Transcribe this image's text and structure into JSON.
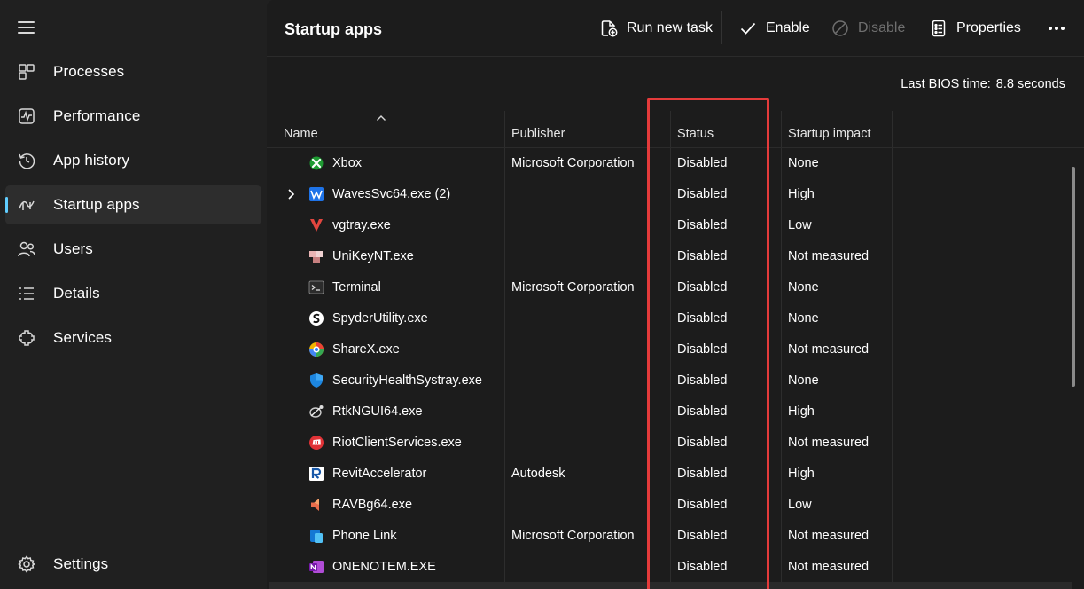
{
  "sidebar": {
    "items": [
      {
        "label": "Processes",
        "icon": "processes-icon"
      },
      {
        "label": "Performance",
        "icon": "performance-icon"
      },
      {
        "label": "App history",
        "icon": "app-history-icon"
      },
      {
        "label": "Startup apps",
        "icon": "startup-apps-icon",
        "active": true
      },
      {
        "label": "Users",
        "icon": "users-icon"
      },
      {
        "label": "Details",
        "icon": "details-icon"
      },
      {
        "label": "Services",
        "icon": "services-icon"
      }
    ],
    "settings": {
      "label": "Settings",
      "icon": "gear-icon"
    }
  },
  "header": {
    "title": "Startup apps",
    "run_new_task": "Run new task",
    "enable": "Enable",
    "disable": "Disable",
    "properties": "Properties"
  },
  "bios": {
    "label": "Last BIOS time:",
    "value": "8.8 seconds"
  },
  "table": {
    "columns": [
      "Name",
      "Publisher",
      "Status",
      "Startup impact"
    ],
    "rows": [
      {
        "name": "Xbox",
        "publisher": "Microsoft Corporation",
        "status": "Disabled",
        "impact": "None",
        "icon": "xbox-icon"
      },
      {
        "name": "WavesSvc64.exe (2)",
        "publisher": "",
        "status": "Disabled",
        "impact": "High",
        "icon": "waves-icon",
        "expandable": true
      },
      {
        "name": "vgtray.exe",
        "publisher": "",
        "status": "Disabled",
        "impact": "Low",
        "icon": "vanguard-icon"
      },
      {
        "name": "UniKeyNT.exe",
        "publisher": "",
        "status": "Disabled",
        "impact": "Not measured",
        "icon": "unikey-icon"
      },
      {
        "name": "Terminal",
        "publisher": "Microsoft Corporation",
        "status": "Disabled",
        "impact": "None",
        "icon": "terminal-icon"
      },
      {
        "name": "SpyderUtility.exe",
        "publisher": "",
        "status": "Disabled",
        "impact": "None",
        "icon": "spyder-icon"
      },
      {
        "name": "ShareX.exe",
        "publisher": "",
        "status": "Disabled",
        "impact": "Not measured",
        "icon": "sharex-icon"
      },
      {
        "name": "SecurityHealthSystray.exe",
        "publisher": "",
        "status": "Disabled",
        "impact": "None",
        "icon": "security-shield-icon"
      },
      {
        "name": "RtkNGUI64.exe",
        "publisher": "",
        "status": "Disabled",
        "impact": "High",
        "icon": "realtek-icon"
      },
      {
        "name": "RiotClientServices.exe",
        "publisher": "",
        "status": "Disabled",
        "impact": "Not measured",
        "icon": "riot-icon"
      },
      {
        "name": "RevitAccelerator",
        "publisher": "Autodesk",
        "status": "Disabled",
        "impact": "High",
        "icon": "revit-icon"
      },
      {
        "name": "RAVBg64.exe",
        "publisher": "",
        "status": "Disabled",
        "impact": "Low",
        "icon": "speaker-icon"
      },
      {
        "name": "Phone Link",
        "publisher": "Microsoft Corporation",
        "status": "Disabled",
        "impact": "Not measured",
        "icon": "phone-link-icon"
      },
      {
        "name": "ONENOTEM.EXE",
        "publisher": "",
        "status": "Disabled",
        "impact": "Not measured",
        "icon": "onenote-icon"
      }
    ]
  },
  "colors": {
    "accent": "#60cdff",
    "highlight": "#e53b3b",
    "background": "#1c1c1c",
    "sidebar": "#202020"
  }
}
